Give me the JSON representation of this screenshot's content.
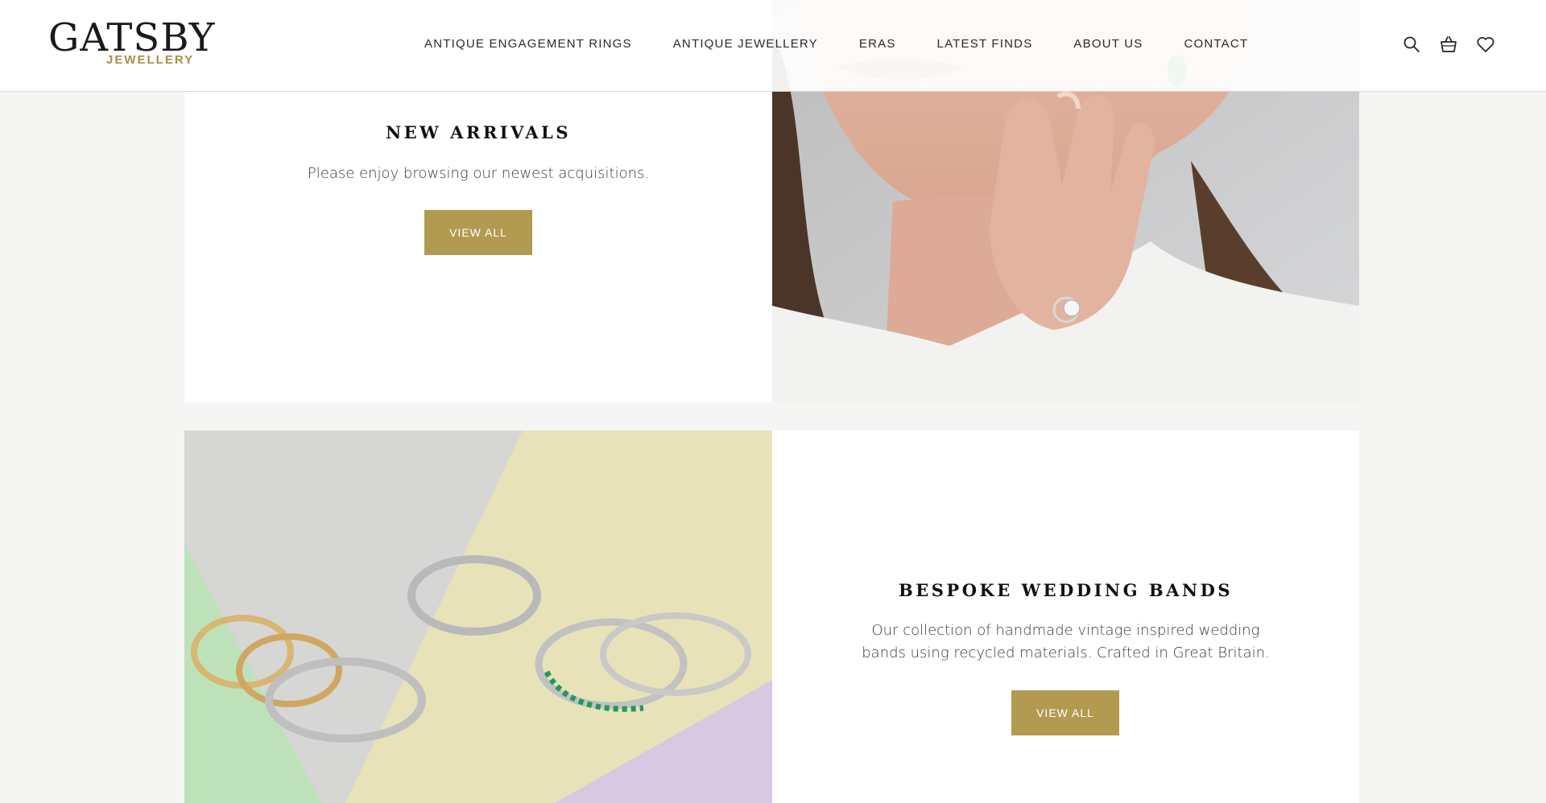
{
  "brand": {
    "name": "GATSBY",
    "sub": "JEWELLERY",
    "accent": "#b39a51"
  },
  "nav": {
    "items": [
      {
        "label": "ANTIQUE ENGAGEMENT RINGS"
      },
      {
        "label": "ANTIQUE JEWELLERY"
      },
      {
        "label": "ERAS"
      },
      {
        "label": "LATEST FINDS"
      },
      {
        "label": "ABOUT US"
      },
      {
        "label": "CONTACT"
      }
    ]
  },
  "header_icons": [
    "search-icon",
    "basket-icon",
    "heart-icon"
  ],
  "new_arrivals": {
    "title": "NEW ARRIVALS",
    "text": "Please enjoy browsing our newest acquisitions.",
    "button": "VIEW ALL"
  },
  "wedding_bands": {
    "title": "BESPOKE WEDDING BANDS",
    "text_line1": "Our collection of handmade vintage inspired wedding",
    "text_line2": "bands using recycled materials. Crafted in Great Britain.",
    "button": "VIEW ALL"
  }
}
